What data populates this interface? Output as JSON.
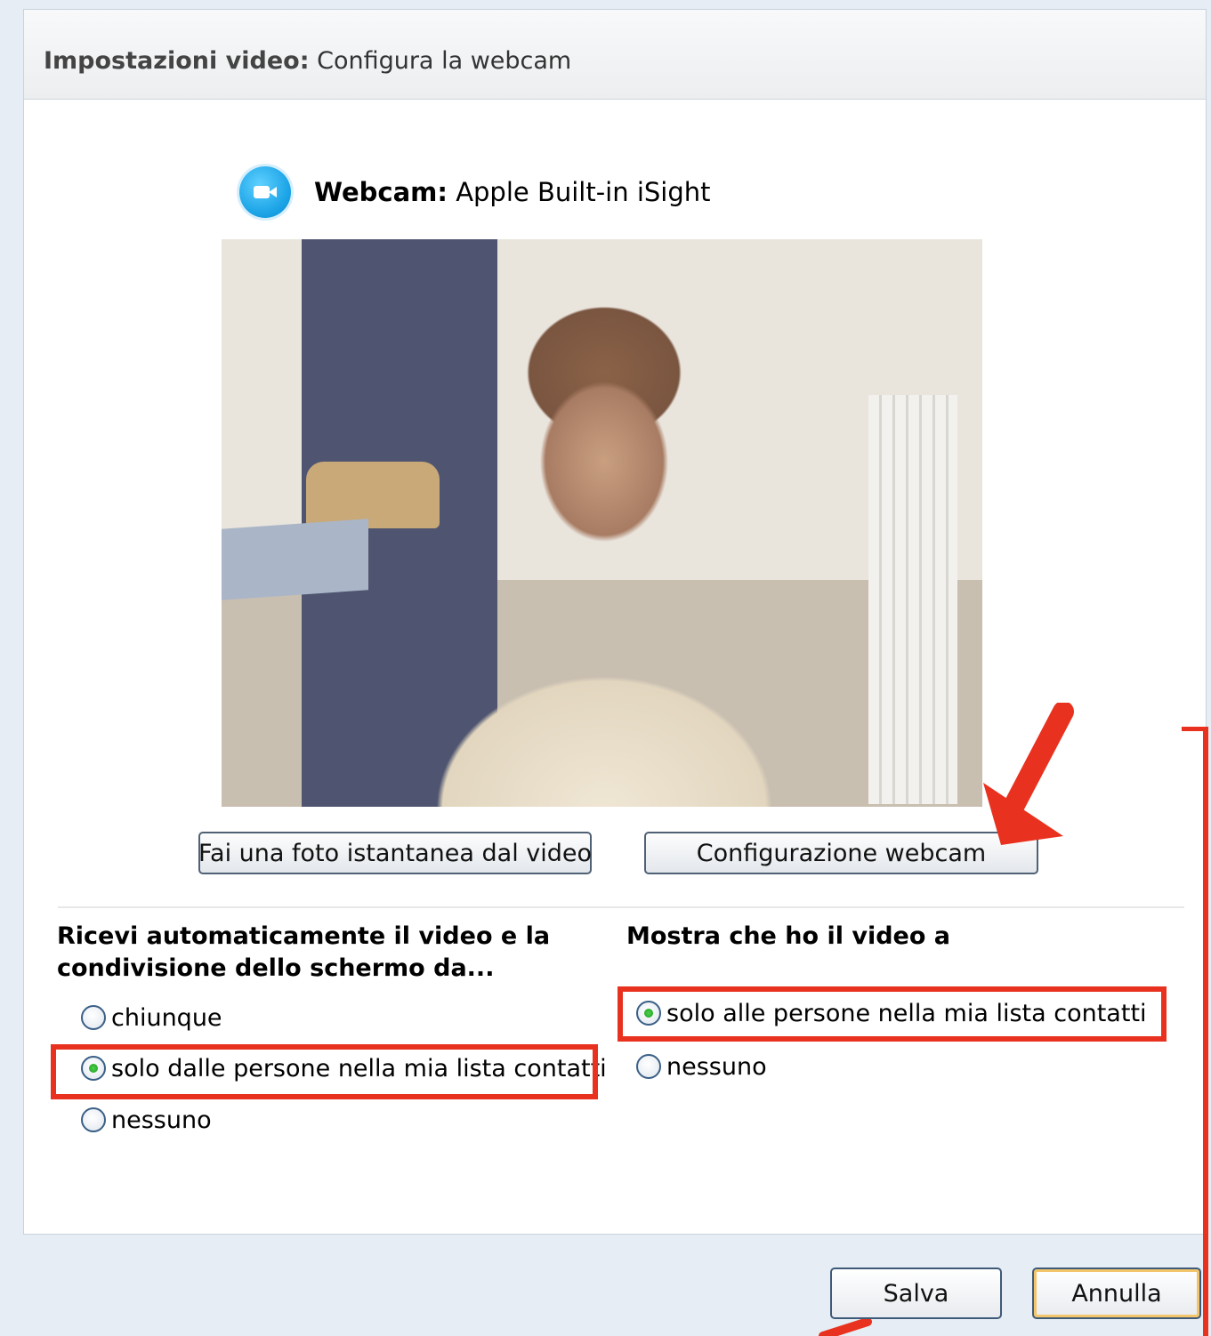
{
  "header": {
    "title_bold": "Impostazioni video:",
    "title_rest": "Configura la webcam"
  },
  "webcam": {
    "label": "Webcam:",
    "device": "Apple Built-in iSight",
    "icon": "video-camera-icon"
  },
  "buttons": {
    "snapshot": "Fai una foto istantanea dal video",
    "configure": "Configurazione webcam"
  },
  "receive": {
    "title": "Ricevi automaticamente il video e la condivisione dello schermo da...",
    "options": [
      "chiunque",
      "solo dalle persone nella mia lista contatti",
      "nessuno"
    ],
    "selected": "solo dalle persone nella mia lista contatti"
  },
  "show": {
    "title": "Mostra che ho il video a",
    "options": [
      "solo alle persone nella mia lista contatti",
      "nessuno"
    ],
    "selected": "solo alle persone nella mia lista contatti"
  },
  "footer": {
    "save": "Salva",
    "cancel": "Annulla"
  },
  "colors": {
    "annotation": "#e8321f",
    "background": "#e6edf4",
    "radio_selected": "#1b9a1b"
  }
}
